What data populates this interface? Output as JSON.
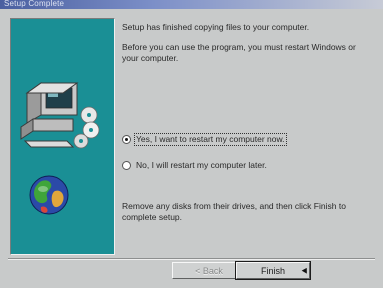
{
  "window": {
    "title": "Setup Complete"
  },
  "messages": {
    "copied": "Setup has finished copying files to your computer.",
    "restart_prompt": "Before you can use the program, you must restart Windows or your computer.",
    "remove_disks": "Remove any disks from their drives, and then click Finish to complete setup."
  },
  "options": {
    "yes_label": "Yes, I want to restart my computer now.",
    "no_label": "No, I will restart my computer later.",
    "selected": "yes"
  },
  "buttons": {
    "back_label": "< Back",
    "finish_label": "Finish"
  },
  "icons": {
    "computer": "computer-icon",
    "cds": "cd-disc-icon",
    "globe": "globe-icon"
  },
  "colors": {
    "panel_bg": "#1a8f95",
    "dialog_bg": "#c8caca"
  }
}
